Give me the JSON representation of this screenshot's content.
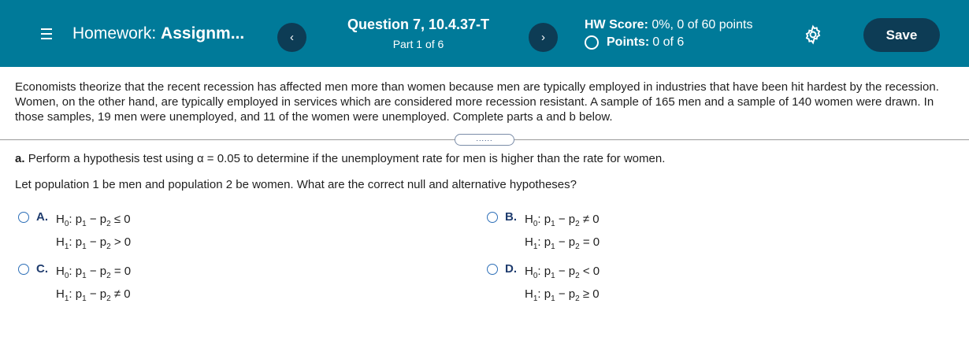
{
  "header": {
    "menu_icon": "hamburger-menu-icon",
    "hw_prefix": "Homework:",
    "hw_name": "Assignm...",
    "prev_label": "‹",
    "next_label": "›",
    "question_title": "Question 7, 10.4.37-T",
    "question_part": "Part 1 of 6",
    "hw_score_label": "HW Score:",
    "hw_score_value": "0%, 0 of 60 points",
    "points_label": "Points:",
    "points_value": "0 of 6",
    "settings_icon": "gear-icon",
    "save_label": "Save",
    "colors": {
      "bar": "#007a99",
      "button": "#0d3c55"
    }
  },
  "problem": {
    "intro": "Economists theorize that the recent recession has affected men more than women because men are typically employed in industries that have been hit hardest by the recession. Women, on the other hand, are typically employed in services which are considered more recession resistant. A sample of 165 men and a sample of 140 women were drawn. In those samples, 19 men were unemployed, and 11 of the women were unemployed. Complete parts a and b below.",
    "expander_label": "......",
    "part_a_letter": "a.",
    "part_a_text": "Perform a hypothesis test using α = 0.05 to determine if the unemployment rate for men is higher than the rate for women.",
    "prompt": "Let population 1 be men and population 2 be women. What are the correct null and alternative hypotheses?"
  },
  "choices": [
    {
      "letter": "A.",
      "h0_rel": "≤",
      "h0_val": "0",
      "h1_rel": ">",
      "h1_val": "0"
    },
    {
      "letter": "B.",
      "h0_rel": "≠",
      "h0_val": "0",
      "h1_rel": "=",
      "h1_val": "0"
    },
    {
      "letter": "C.",
      "h0_rel": "=",
      "h0_val": "0",
      "h1_rel": "≠",
      "h1_val": "0"
    },
    {
      "letter": "D.",
      "h0_rel": "<",
      "h0_val": "0",
      "h1_rel": "≥",
      "h1_val": "0"
    }
  ]
}
